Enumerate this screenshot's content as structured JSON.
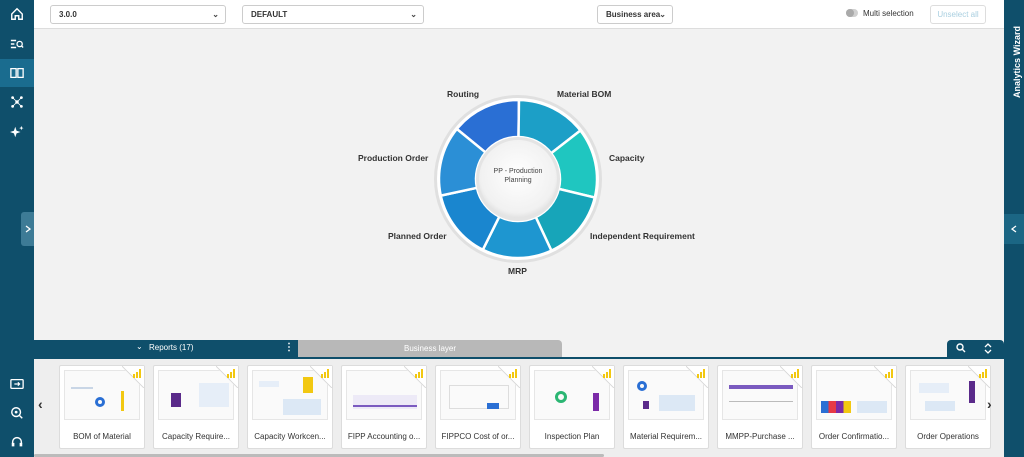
{
  "toolbar": {
    "version_select": "3.0.0",
    "scenario_select": "DEFAULT",
    "view_select": "Business area",
    "multi_selection_label": "Multi selection",
    "unselect_all_label": "Unselect all"
  },
  "left_nav": {
    "items": [
      "home-icon",
      "search-list-icon",
      "book-icon",
      "network-icon",
      "sparkle-icon"
    ],
    "bottom_items": [
      "export-icon",
      "settings-search-icon",
      "support-icon"
    ]
  },
  "right_panel": {
    "title": "Analytics Wizard"
  },
  "wheel": {
    "center_label": "PP - Production Planning",
    "segments": [
      {
        "label": "Routing",
        "color": "#2a6fd4"
      },
      {
        "label": "Material BOM",
        "color": "#1c9fc7"
      },
      {
        "label": "Capacity",
        "color": "#1fc6c0"
      },
      {
        "label": "Independent Requirement",
        "color": "#17a5b9"
      },
      {
        "label": "MRP",
        "color": "#1e96d0"
      },
      {
        "label": "Planned Order",
        "color": "#1a86cf"
      },
      {
        "label": "Production Order",
        "color": "#2b8fd6"
      }
    ]
  },
  "bottom": {
    "reports_tab": "Reports",
    "reports_count": "(17)",
    "layer_tab": "Business layer",
    "cards": [
      "BOM of Material",
      "Capacity Require...",
      "Capacity Workcen...",
      "FIPP Accounting o...",
      "FIPPCO Cost of or...",
      "Inspection Plan",
      "Material Requirem...",
      "MMPP-Purchase ...",
      "Order Confirmatio...",
      "Order Operations"
    ]
  },
  "colors": {
    "sidebar": "#0f4f6b",
    "accent": "#1a6c8f",
    "powerbi": "#f2c811"
  }
}
